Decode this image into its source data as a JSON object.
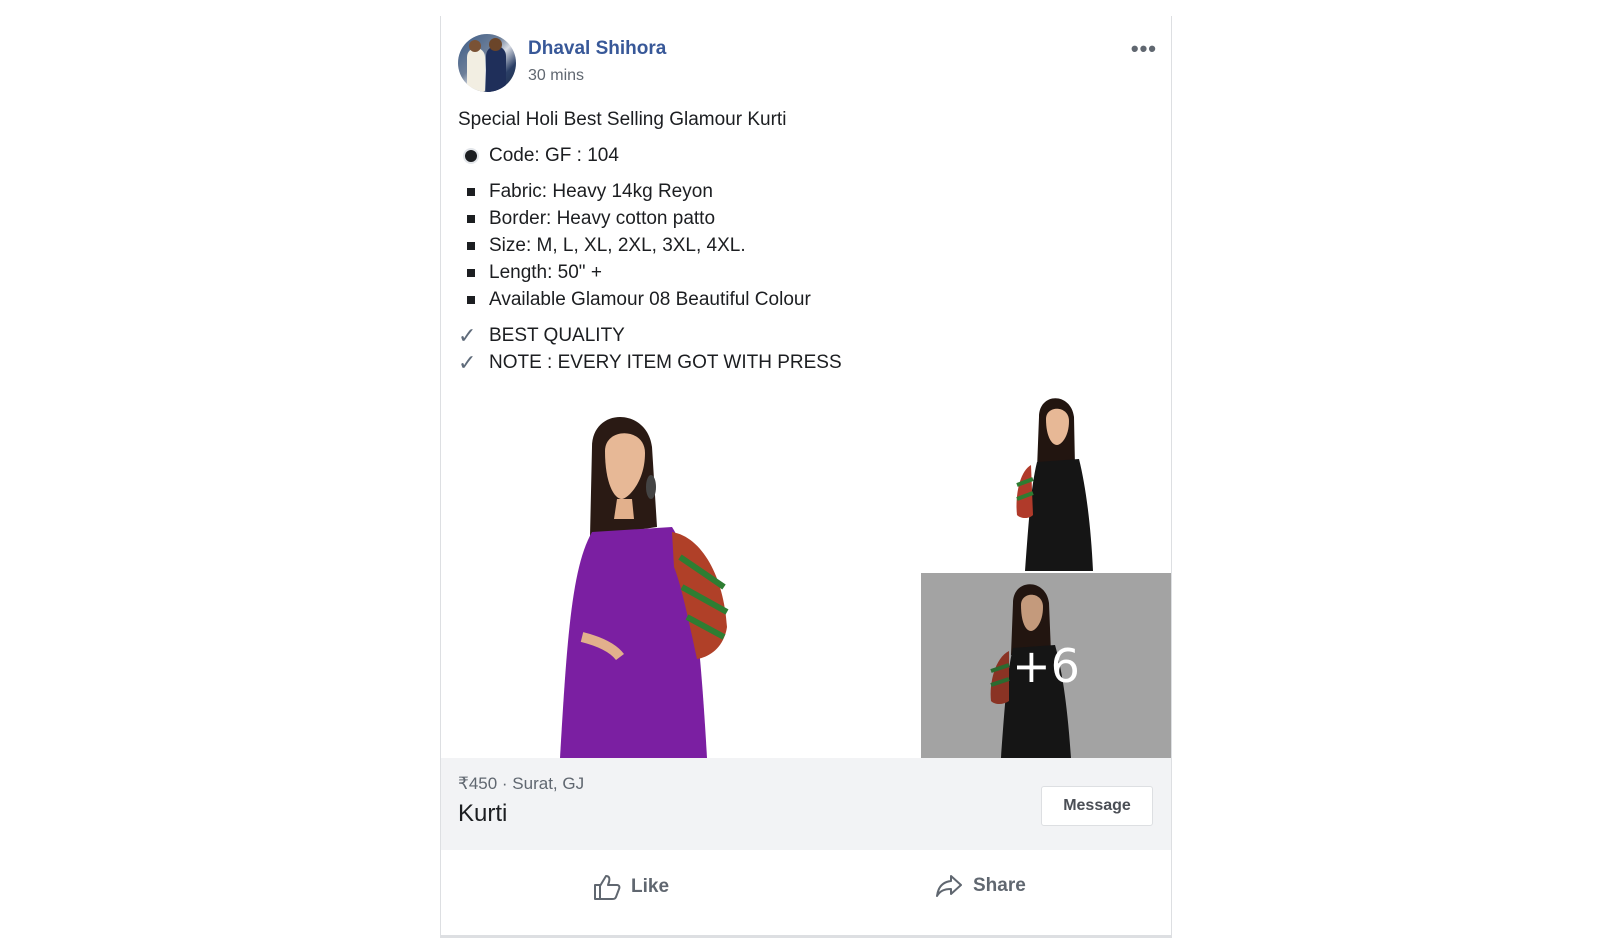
{
  "post": {
    "author": "Dhaval Shihora",
    "time": "30 mins",
    "more_label": "•••",
    "headline": "Special Holi Best Selling Glamour Kurti",
    "code": "Code: GF : 104",
    "details": [
      "Fabric: Heavy 14kg Reyon",
      "Border: Heavy cotton patto",
      "Size: M, L, XL, 2XL, 3XL, 4XL.",
      "Length: 50\" +",
      "Available Glamour 08 Beautiful Colour"
    ],
    "checks": [
      "BEST QUALITY",
      "NOTE : EVERY ITEM GOT WITH PRESS"
    ]
  },
  "photos": {
    "main_color": "#7b1fa2",
    "thumb_color": "#151515",
    "more_count": "+6"
  },
  "listing": {
    "price_location": "₹450 · Surat, GJ",
    "title": "Kurti",
    "message_button": "Message"
  },
  "actions": {
    "like": "Like",
    "share": "Share"
  },
  "icons": [
    "more-icon",
    "bullet-icon",
    "square-bullet-icon",
    "check-icon",
    "like-icon",
    "share-icon"
  ]
}
